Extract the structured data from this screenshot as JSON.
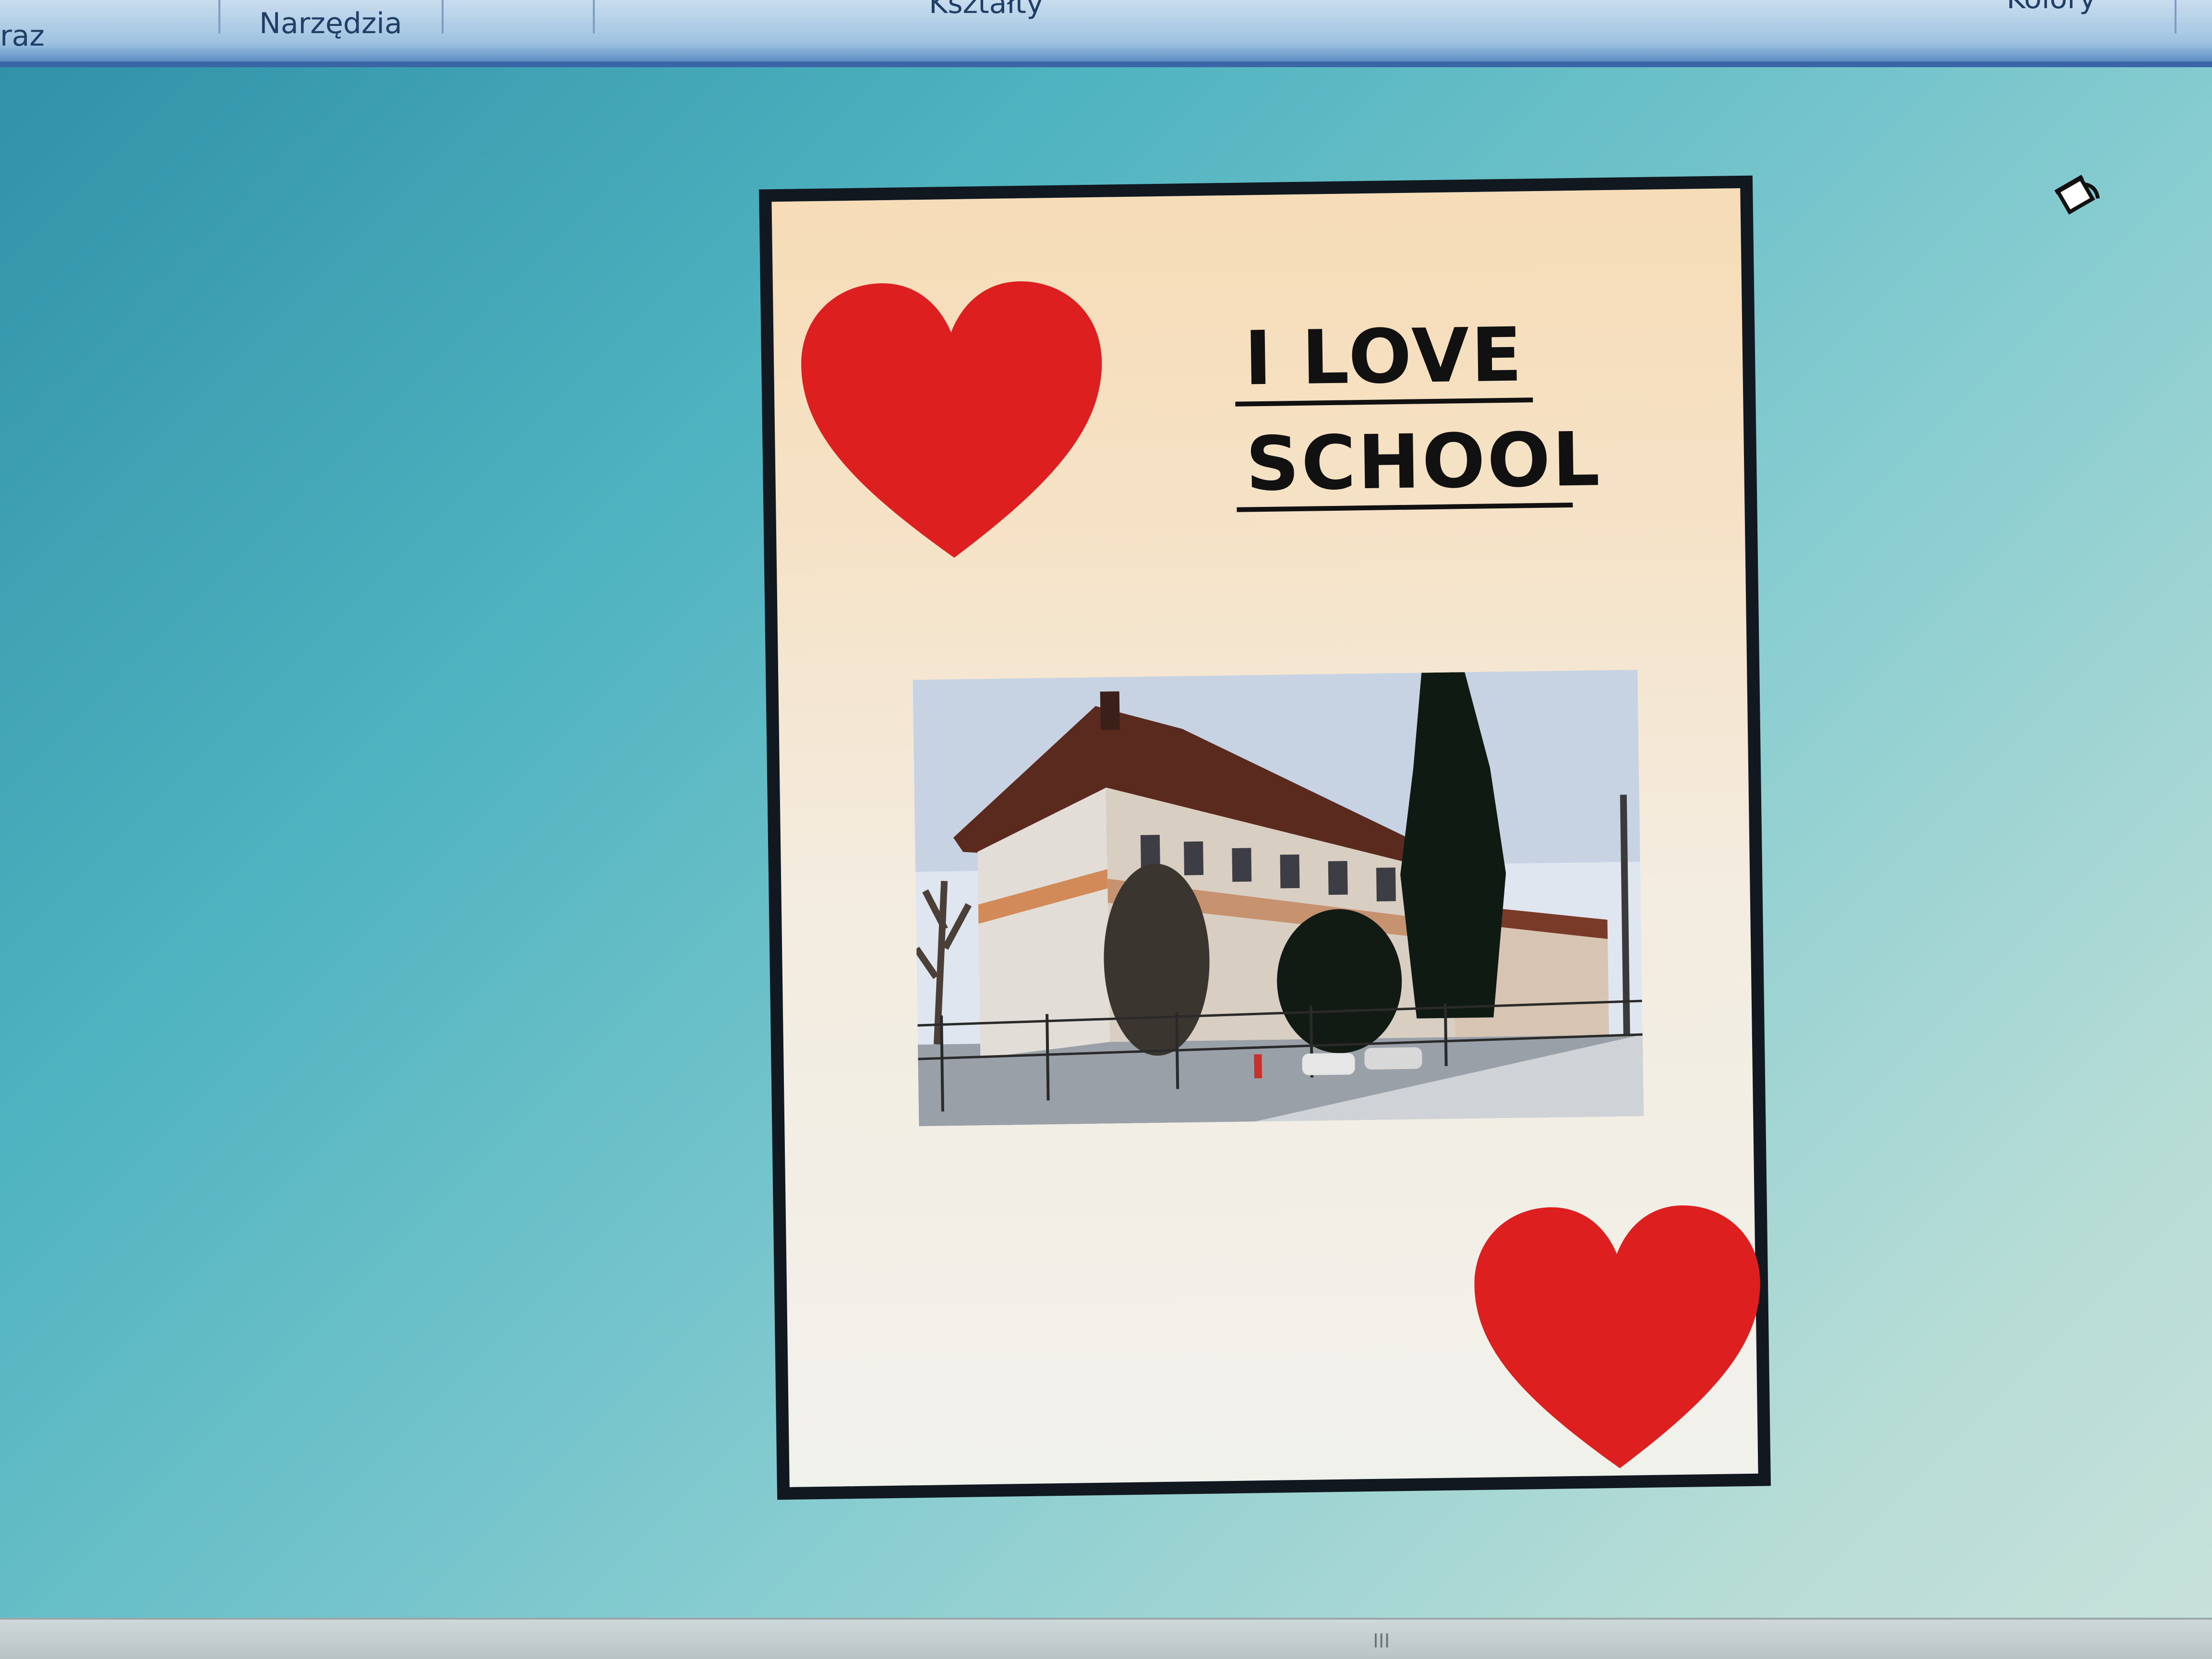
{
  "ribbon": {
    "items": [
      {
        "label": "raz"
      },
      {
        "label": "Narzędzia"
      },
      {
        "label": "Kształty"
      },
      {
        "label": "Kolory"
      }
    ]
  },
  "poster": {
    "title_line1": "I LOVE",
    "title_line2": "SCHOOL",
    "heart_color": "#e02020",
    "photo_subject": "school-building-photo"
  },
  "cursor": {
    "icon": "paint-bucket-icon"
  },
  "scrollbar": {
    "grip": "III"
  }
}
